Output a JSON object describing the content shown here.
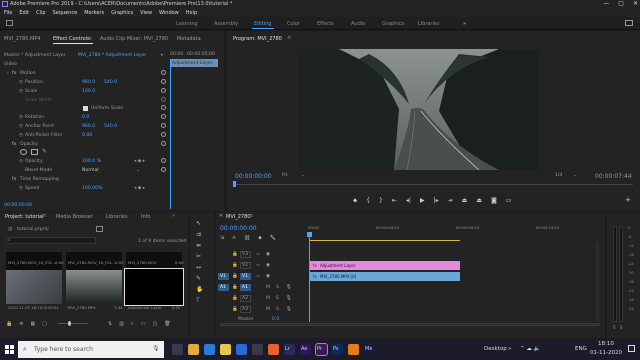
{
  "window": {
    "title": "Adobe Premiere Pro 2019 - C:\\Users\\ACER\\Documents\\Adobe\\Premiere Pro\\13.0\\tutorial *",
    "controls": [
      "—",
      "▢",
      "✕"
    ]
  },
  "menu": [
    "File",
    "Edit",
    "Clip",
    "Sequence",
    "Markers",
    "Graphics",
    "View",
    "Window",
    "Help"
  ],
  "workspaces": {
    "tabs": [
      "Learning",
      "Assembly",
      "Editing",
      "Color",
      "Effects",
      "Audio",
      "Graphics",
      "Libraries"
    ],
    "active": "Editing",
    "more": "»"
  },
  "source_panel": {
    "tabs": [
      "MVI_2780.MP4",
      "Effect Controls",
      "Audio Clip Mixer: MVI_2780",
      "Metadata"
    ],
    "active_tab": "Effect Controls",
    "master_label": "Master * Adjustment Layer",
    "clip_label": "MVI_2780 * Adjustment Layer",
    "mini_timecode": "00:00",
    "mini_timecode2": "00:00:05:00",
    "clip_bar": "Adjustment Layer",
    "section_video": "Video",
    "motion": {
      "title": "Motion",
      "position_label": "Position",
      "position_x": "960.0",
      "position_y": "540.0",
      "scale_label": "Scale",
      "scale_val": "100.0",
      "scale_width_label": "Scale Width",
      "uniform_label": "Uniform Scale",
      "rotation_label": "Rotation",
      "rotation_val": "0.0",
      "anchor_label": "Anchor Point",
      "anchor_x": "960.0",
      "anchor_y": "540.0",
      "flicker_label": "Anti-flicker Filter",
      "flicker_val": "0.00"
    },
    "opacity": {
      "title": "Opacity",
      "opacity_label": "Opacity",
      "opacity_val": "100.0 %",
      "blend_label": "Blend Mode",
      "blend_val": "Normal"
    },
    "time_remap": {
      "title": "Time Remapping",
      "speed_label": "Speed",
      "speed_val": "100.00%"
    },
    "timecode": "00:00:00:00"
  },
  "program": {
    "title": "Program: MVI_2780",
    "timecode": "00:00:00:00",
    "fit": "Fit",
    "ratio": "1/4",
    "duration": "00:00:07:44"
  },
  "project": {
    "tabs": [
      "Project: tutorial",
      "Media Browser",
      "Libraries",
      "Info"
    ],
    "file": "tutorial.prproj",
    "selection": "1 of 9 items selected",
    "thumbs": [
      {
        "name": "MVI_2780.MOV_1K_ECL...",
        "dur": "0:00"
      },
      {
        "name": "MVI_2780.MOV_1K_ECL...",
        "dur": "0:00"
      },
      {
        "name": "MVI_2780.MOV",
        "dur": "0:00"
      },
      {
        "name": "2020-11-01 18:10:...",
        "dur": "3:03:04"
      },
      {
        "name": "MVI_2780.MP4",
        "dur": "7:44"
      },
      {
        "name": "Adjustment Layer",
        "dur": "5:00"
      }
    ]
  },
  "timeline": {
    "title": "MVI_2780",
    "timecode": "00:00:00:00",
    "tracks_video": [
      "V3",
      "V2",
      "V1"
    ],
    "tracks_audio": [
      "A1",
      "A2",
      "A3"
    ],
    "track_controls": [
      "M",
      "S"
    ],
    "master_label": "Master",
    "master_val": "0.0",
    "src_v1": "V1",
    "src_a1": "A1",
    "clip_adjustment": "Adjustment Layer",
    "clip_video": "MVI_2780.MP4 [V]",
    "ruler_marks": [
      "00:00",
      "00:00:04:23",
      "00:00:09:23",
      "00:00:14:23"
    ],
    "fx_badges": [
      "fx",
      "fx"
    ]
  },
  "audio_meter": {
    "scale": [
      "0",
      "-6",
      "-12",
      "-18",
      "-24",
      "-30",
      "-36",
      "-42",
      "-48",
      "-54"
    ],
    "channels": [
      "S",
      "S"
    ]
  },
  "taskbar": {
    "search_placeholder": "Type here to search",
    "desktop_label": "Desktop",
    "tray": "⌃ ☁ 🔈",
    "lang": "ENG",
    "time": "18:10",
    "date": "01-11-2020",
    "apps": [
      {
        "name": "task-view",
        "color": "#3a3a4a"
      },
      {
        "name": "chrome",
        "color": "#e8a838"
      },
      {
        "name": "edge",
        "color": "#2a7ad8"
      },
      {
        "name": "file-explorer",
        "color": "#e8c84a"
      },
      {
        "name": "mail",
        "color": "#2a6ad8"
      },
      {
        "name": "store",
        "color": "#3a3a4a"
      },
      {
        "name": "firefox",
        "color": "#e8622a"
      },
      {
        "name": "lightroom",
        "color": "#2a2a58"
      },
      {
        "name": "after-effects",
        "color": "#2a1a58"
      },
      {
        "name": "premiere",
        "color": "#3a1a58"
      },
      {
        "name": "photoshop",
        "color": "#0a2a58"
      },
      {
        "name": "vlc",
        "color": "#e87a1a"
      },
      {
        "name": "media-encoder",
        "color": "#1a1a3a"
      }
    ],
    "app_labels": [
      "",
      "",
      "",
      "",
      "",
      "",
      "",
      "Lr",
      "Ae",
      "Pr",
      "Ps",
      "",
      "Me"
    ]
  },
  "colors": {
    "accent": "#4da3ff",
    "clip_adjustment": "#e58ad8",
    "clip_video": "#6aa8d8",
    "taskbar": "#1b1b2a"
  }
}
